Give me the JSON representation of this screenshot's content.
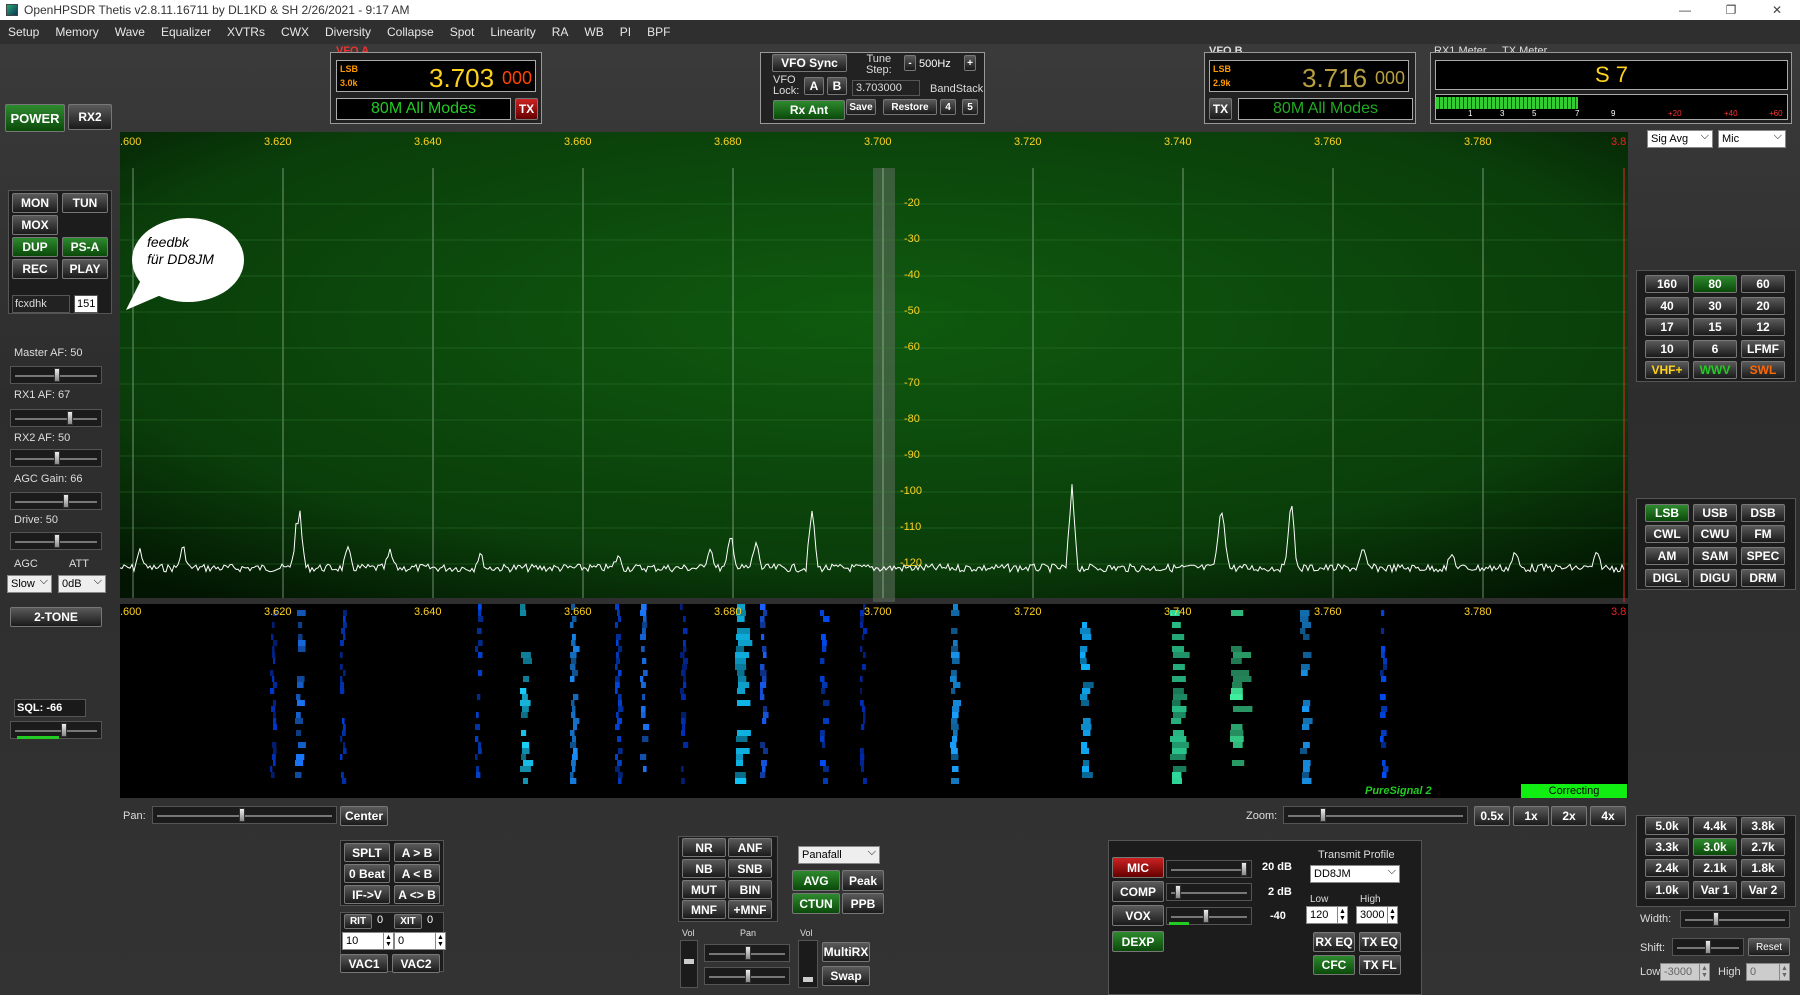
{
  "titlebar": {
    "title": "OpenHPSDR Thetis v2.8.11.16711 by DL1KD & SH 2/26/2021 - 9:17 AM",
    "minimize": "—",
    "restore": "❐",
    "close": "✕"
  },
  "menu": [
    "Setup",
    "Memory",
    "Wave",
    "Equalizer",
    "XVTRs",
    "CWX",
    "Diversity",
    "Collapse",
    "Spot",
    "Linearity",
    "RA",
    "WB",
    "PI",
    "BPF"
  ],
  "left": {
    "power": "POWER",
    "rx2": "RX2",
    "mon": "MON",
    "tun": "TUN",
    "mox": "MOX",
    "dup": "DUP",
    "psa": "PS-A",
    "rec": "REC",
    "play": "PLAY",
    "mem_name": "fcxdhk",
    "mem_num": "151",
    "master_af": "Master AF:  50",
    "rx1_af": "RX1 AF:  67",
    "rx2_af": "RX2 AF:  50",
    "agc_gain": "AGC Gain:  66",
    "drive": "Drive:  50",
    "agc": "AGC",
    "att": "ATT",
    "agc_val": "Slow",
    "att_val": "0dB",
    "two_tone": "2-TONE",
    "sql": "SQL:  -66"
  },
  "vfoa": {
    "label": "VFO A",
    "mode": "LSB",
    "bw": "3.0k",
    "freq": "3.703",
    "sub": "000",
    "band": "80M All Modes",
    "tx": "TX"
  },
  "vfob": {
    "label": "VFO B",
    "mode": "LSB",
    "bw": "2.9k",
    "freq": "3.716",
    "sub": "000",
    "band": "80M All Modes",
    "tx": "TX"
  },
  "vfoctl": {
    "sync": "VFO Sync",
    "tune_step": "Tune\nStep:",
    "step_val": "500Hz",
    "lock": "VFO\nLock:",
    "a": "A",
    "b": "B",
    "freq_entry": "3.703000",
    "bandstack": "BandStack",
    "rx_ant": "Rx Ant",
    "save": "Save",
    "restore": "Restore",
    "four": "4",
    "five": "5"
  },
  "meter": {
    "rx1": "RX1 Meter",
    "tx": "TX Meter",
    "reading": "S 7",
    "scale": [
      "1",
      "3",
      "5",
      "7",
      "9",
      "+20",
      "+40",
      "+60"
    ],
    "sel1": "Sig Avg",
    "sel2": "Mic"
  },
  "display": {
    "freq_ticks": [
      ".600",
      "3.620",
      "3.640",
      "3.660",
      "3.680",
      "3.700",
      "3.720",
      "3.740",
      "3.760",
      "3.780",
      "3.8"
    ],
    "db_ticks": [
      "-20",
      "-30",
      "-40",
      "-50",
      "-60",
      "-70",
      "-80",
      "-90",
      "-100",
      "-110",
      "-120"
    ],
    "bubble": "feedbk\nfür DD8JM",
    "puresignal": "PureSignal 2",
    "correcting": "Correcting"
  },
  "bands": [
    "160",
    "80",
    "60",
    "40",
    "30",
    "20",
    "17",
    "15",
    "12",
    "10",
    "6",
    "LFMF",
    "VHF+",
    "WWV",
    "SWL"
  ],
  "modes": [
    "LSB",
    "USB",
    "DSB",
    "CWL",
    "CWU",
    "FM",
    "AM",
    "SAM",
    "SPEC",
    "DIGL",
    "DIGU",
    "DRM"
  ],
  "filters": [
    "5.0k",
    "4.4k",
    "3.8k",
    "3.3k",
    "3.0k",
    "2.7k",
    "2.4k",
    "2.1k",
    "1.8k",
    "1.0k",
    "Var 1",
    "Var 2"
  ],
  "filterctl": {
    "width": "Width:",
    "shift": "Shift:",
    "reset": "Reset",
    "low": "Low",
    "high": "High",
    "low_val": "-3000",
    "high_val": "0"
  },
  "bottom": {
    "pan": "Pan:",
    "center": "Center",
    "zoom": "Zoom:",
    "z05": "0.5x",
    "z1": "1x",
    "z2": "2x",
    "z4": "4x",
    "splt": "SPLT",
    "atob": "A > B",
    "zerobeat": "0 Beat",
    "altb": "A < B",
    "ifv": "IF->V",
    "aswapb": "A <> B",
    "rit": "RIT",
    "rit_val": "0",
    "xit": "XIT",
    "xit_val": "0",
    "rit_entry": "10",
    "xit_entry": "0",
    "vac1": "VAC1",
    "vac2": "VAC2",
    "nr": "NR",
    "anf": "ANF",
    "nb": "NB",
    "snb": "SNB",
    "mut": "MUT",
    "bin": "BIN",
    "mnf": "MNF",
    "pmnf": "+MNF",
    "display_mode": "Panafall",
    "avg": "AVG",
    "peak": "Peak",
    "ctun": "CTUN",
    "ppb": "PPB",
    "vol": "Vol",
    "pan2": "Pan",
    "vol2": "Vol",
    "multirx": "MultiRX",
    "swap": "Swap",
    "mic": "MIC",
    "mic_val": "20 dB",
    "comp": "COMP",
    "comp_val": "2 dB",
    "vox": "VOX",
    "vox_val": "-40",
    "dexp": "DEXP",
    "tx_profile": "Transmit Profile",
    "profile_val": "DD8JM",
    "low": "Low",
    "high": "High",
    "low_val": "120",
    "high_val": "3000",
    "rxeq": "RX EQ",
    "txeq": "TX EQ",
    "cfc": "CFC",
    "txfl": "TX FL"
  },
  "colors": {
    "green_btn": "#2e8a2e",
    "vfo_yellow": "#ffd21e",
    "band_green": "#22cc22",
    "pan_bg": "#0a3a0a"
  }
}
